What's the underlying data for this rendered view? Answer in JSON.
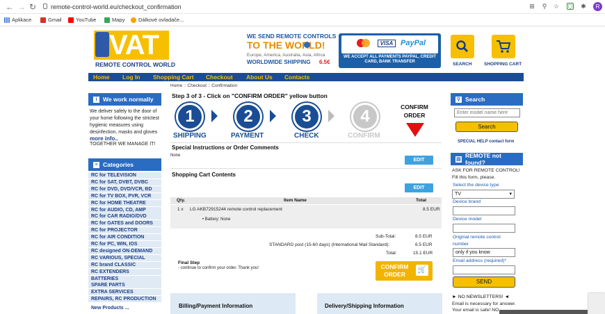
{
  "browser": {
    "url": "remote-control-world.eu/checkout_confirmation",
    "bookmarks": [
      "Aplikace",
      "Gmail",
      "YouTube",
      "Mapy",
      "Dálkové ovladače..."
    ],
    "avatar_letter": "R"
  },
  "header": {
    "logo": "VAT",
    "logo_sub": "REMOTE CONTROL WORLD",
    "ship_line1": "WE SEND REMOTE CONTROLS",
    "ship_line2": "TO THE WORLD!",
    "ship_line3": "Europe, America, Australia, Asia, Africa",
    "ship_line4": "WORLDWIDE SHIPPING",
    "ship_price": "6.5€",
    "visa": "VISA",
    "paypal": "PayPal",
    "pay_text": "WE ACCEPT ALL PAYMENTS PAYPAL, CREDIT CARD, BANK TRANSFER",
    "search_label": "SEARCH",
    "cart_label": "SHOPPING CART"
  },
  "nav": [
    "Home",
    "Log In",
    "Shopping Cart",
    "Checkout",
    "About Us",
    "Contacts"
  ],
  "left": {
    "we_work_title": "We work normally",
    "we_work_text": "We deliver safely to the door of your home following the strictest hygienic measures using desinfection, masks and gloves",
    "more_info": "more info..",
    "together": "TOGETHER WE MANAGE IT!",
    "categories_title": "Categories",
    "categories": [
      "RC for TELEVISION",
      "RC for SAT, DVBT, DVBC",
      "RC for DVD, DVD/VCR, BD",
      "RC for TV BOX, PVR, VCR",
      "RC for HOME THEATRE",
      "RC for AUDIO, CD, AMP",
      "RC for CAR RADIO/DVD",
      "RC for GATES and DOORS",
      "RC for PROJECTOR",
      "RC for AIR CONDITION",
      "RC for PC, WIN, IOS",
      "RC designed ON-DEMAND",
      "RC VARIOUS, SPECIAL",
      "RC brand CLASSIC",
      "RC EXTENDERS",
      "BATTERIES",
      "SPARE PARTS",
      "EXTRA SERVICES",
      "REPAIRS, RC PRODUCTION"
    ],
    "new_products": "New Products ..."
  },
  "main": {
    "breadcrumb": "Home :: Checkout :: Confirmation",
    "step_title": "Step 3 of 3 - Click on \"CONFIRM ORDER\" yellow button",
    "steps": [
      {
        "num": "1",
        "label": "SHIPPING"
      },
      {
        "num": "2",
        "label": "PAYMENT"
      },
      {
        "num": "3",
        "label": "CHECK"
      },
      {
        "num": "4",
        "label": "CONFIRM"
      }
    ],
    "confirm_order": [
      "CONFIRM",
      "ORDER"
    ],
    "instructions_title": "Special Instructions or Order Comments",
    "instructions_value": "None",
    "edit": "EDIT",
    "cart_title": "Shopping Cart Contents",
    "col_qty": "Qty.",
    "col_item": "Item Name",
    "col_total": "Total",
    "item_qty": "1 x",
    "item_name": "LG AKB72915244 remote control replacement",
    "item_price": "8.5 EUR",
    "item_option": "• Battery: None",
    "subtotal_label": "Sub-Total:",
    "subtotal": "8.5 EUR",
    "shipping_label": "STANDARD post (15-60 days) (International Mail Standard):",
    "shipping": "6.5 EUR",
    "total_label": "Total:",
    "total": "15.1 EUR",
    "final_step": "Final Step",
    "final_text": "- continue to confirm your order. Thank you!",
    "confirm_btn": [
      "CONFIRM",
      "ORDER"
    ],
    "billing_title": "Billing/Payment Information",
    "delivery_title": "Delivery/Shipping Information"
  },
  "right": {
    "search_title": "Search",
    "search_placeholder": "Enter model name here",
    "search_btn": "Search",
    "special_help": "SPECIAL HELP contact form",
    "notfound_title": "REMOTE not found?",
    "ask_form": "ASK FOR REMOTE CONTROL!",
    "fill_form": "Fill this form, please.",
    "device_type_label": "Select the device type",
    "device_type": "TV",
    "device_brand": "Device brand",
    "device_model": "Device model",
    "orig_label": "Original remote control number",
    "orig_value": "only if you know",
    "email_label": "Email address (required)*",
    "send": "SEND",
    "newsletter": "► NO NEWSLETTERS! ◄",
    "email_note1": "Email is necessary for answer.",
    "email_note2": "Your email is safe! NO"
  }
}
